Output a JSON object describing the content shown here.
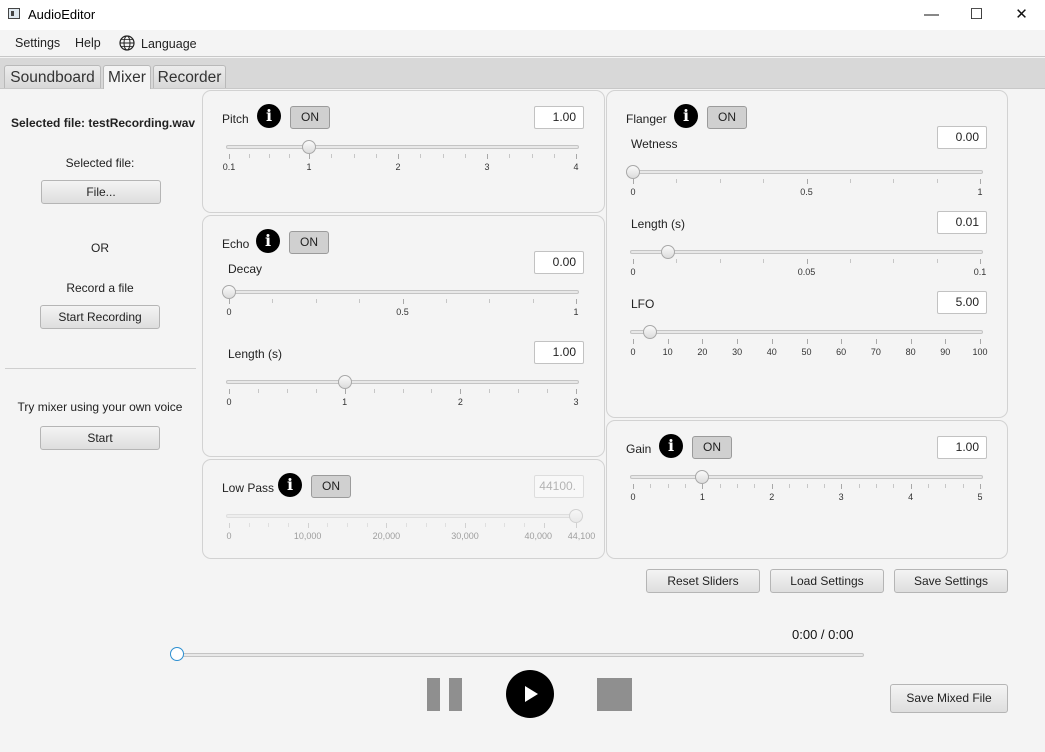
{
  "window": {
    "title": "AudioEditor",
    "minimize": "—",
    "maximize": "☐",
    "close": "✕"
  },
  "menu": {
    "settings": "Settings",
    "help": "Help",
    "language": "Language"
  },
  "tabs": [
    "Soundboard",
    "Mixer",
    "Recorder"
  ],
  "active_tab": "Mixer",
  "sidebar": {
    "selected_file_header": "Selected file: testRecording.wav",
    "selected_file_label": "Selected file:",
    "file_button": "File...",
    "or_label": "OR",
    "record_label": "Record a file",
    "start_recording_button": "Start Recording",
    "try_mixer_label": "Try mixer using your own voice",
    "start_button": "Start"
  },
  "effects": {
    "pitch": {
      "title": "Pitch",
      "toggle": "ON",
      "value": "1.00",
      "slider_value": 1.0,
      "min": 0.1,
      "max": 4,
      "ticks": [
        "0.1",
        "1",
        "2",
        "3",
        "4"
      ]
    },
    "echo": {
      "title": "Echo",
      "toggle": "ON",
      "decay": {
        "label": "Decay",
        "value": "0.00",
        "slider_value": 0.0,
        "min": 0,
        "max": 1,
        "ticks": [
          "0",
          "0.5",
          "1"
        ]
      },
      "length": {
        "label": "Length (s)",
        "value": "1.00",
        "slider_value": 1.0,
        "min": 0,
        "max": 3,
        "ticks": [
          "0",
          "1",
          "2",
          "3"
        ]
      }
    },
    "lowpass": {
      "title": "Low Pass",
      "toggle": "ON",
      "value": "44100.",
      "slider_value": 44100,
      "min": 0,
      "max": 44100,
      "ticks": [
        "0",
        "10,000",
        "20,000",
        "30,000",
        "40,000",
        "44,100"
      ]
    },
    "flanger": {
      "title": "Flanger",
      "toggle": "ON",
      "wetness": {
        "label": "Wetness",
        "value": "0.00",
        "slider_value": 0.0,
        "min": 0,
        "max": 1,
        "ticks": [
          "0",
          "0.5",
          "1"
        ]
      },
      "length": {
        "label": "Length (s)",
        "value": "0.01",
        "slider_value": 0.01,
        "min": 0,
        "max": 0.1,
        "ticks": [
          "0",
          "0.05",
          "0.1"
        ]
      },
      "lfo": {
        "label": "LFO",
        "value": "5.00",
        "slider_value": 5.0,
        "min": 0,
        "max": 100,
        "ticks": [
          "0",
          "10",
          "20",
          "30",
          "40",
          "50",
          "60",
          "70",
          "80",
          "90",
          "100"
        ]
      }
    },
    "gain": {
      "title": "Gain",
      "toggle": "ON",
      "value": "1.00",
      "slider_value": 1.0,
      "min": 0,
      "max": 5,
      "ticks": [
        "0",
        "1",
        "2",
        "3",
        "4",
        "5"
      ]
    }
  },
  "actions": {
    "reset": "Reset Sliders",
    "load": "Load Settings",
    "save": "Save Settings"
  },
  "player": {
    "time": "0:00 / 0:00",
    "progress": 0.0,
    "save_mixed": "Save Mixed File"
  },
  "colors": {
    "accent": "#2c8fd1",
    "toggle_bg": "#d0d0d0",
    "panel_border": "#d2d2d2"
  }
}
